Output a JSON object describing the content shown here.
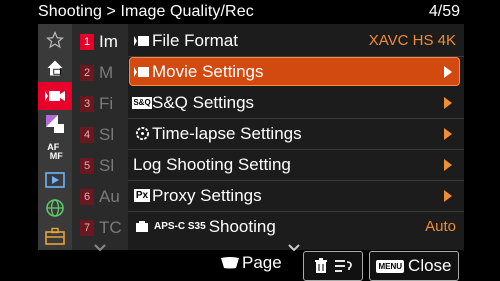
{
  "header": {
    "breadcrumb": "Shooting > Image Quality/Rec",
    "page": "4/59"
  },
  "sidebar": {
    "items": [
      {
        "icon": "star-icon"
      },
      {
        "icon": "camera-home-icon"
      },
      {
        "icon": "movie-camera-icon",
        "active": true
      },
      {
        "icon": "exposure-color-icon"
      },
      {
        "icon": "af-mf-icon"
      },
      {
        "icon": "playback-icon"
      },
      {
        "icon": "network-globe-icon"
      },
      {
        "icon": "toolbox-icon"
      }
    ]
  },
  "background_list": [
    {
      "num": "1",
      "letter": "Im",
      "active": true
    },
    {
      "num": "2",
      "letter": "M"
    },
    {
      "num": "3",
      "letter": "Fi"
    },
    {
      "num": "4",
      "letter": "Sl"
    },
    {
      "num": "5",
      "letter": "Sl"
    },
    {
      "num": "6",
      "letter": "Au"
    },
    {
      "num": "7",
      "letter": "TC"
    }
  ],
  "menu": {
    "items": [
      {
        "label": "File Format",
        "value": "XAVC HS 4K",
        "icon": "file-format-icon"
      },
      {
        "label": "Movie Settings",
        "arrow": true,
        "selected": true,
        "icon": "movie-settings-icon"
      },
      {
        "label": "S&Q Settings",
        "arrow": true,
        "icon": "sq-icon"
      },
      {
        "label": "Time-lapse Settings",
        "arrow": true,
        "icon": "timelapse-icon"
      },
      {
        "label": "Log Shooting Setting",
        "arrow": true,
        "icon": ""
      },
      {
        "label": "Proxy Settings",
        "arrow": true,
        "icon": "proxy-icon"
      },
      {
        "label": "Shooting",
        "value": "Auto",
        "icon": "apsc-s35-icon",
        "badge": "APS-C S35"
      }
    ]
  },
  "footer": {
    "page_label": "Page",
    "close_label": "Close",
    "menu_badge": "MENU"
  },
  "colors": {
    "accent": "#f08c32",
    "selected": "#d24a10",
    "tab_active": "#e7002a"
  }
}
